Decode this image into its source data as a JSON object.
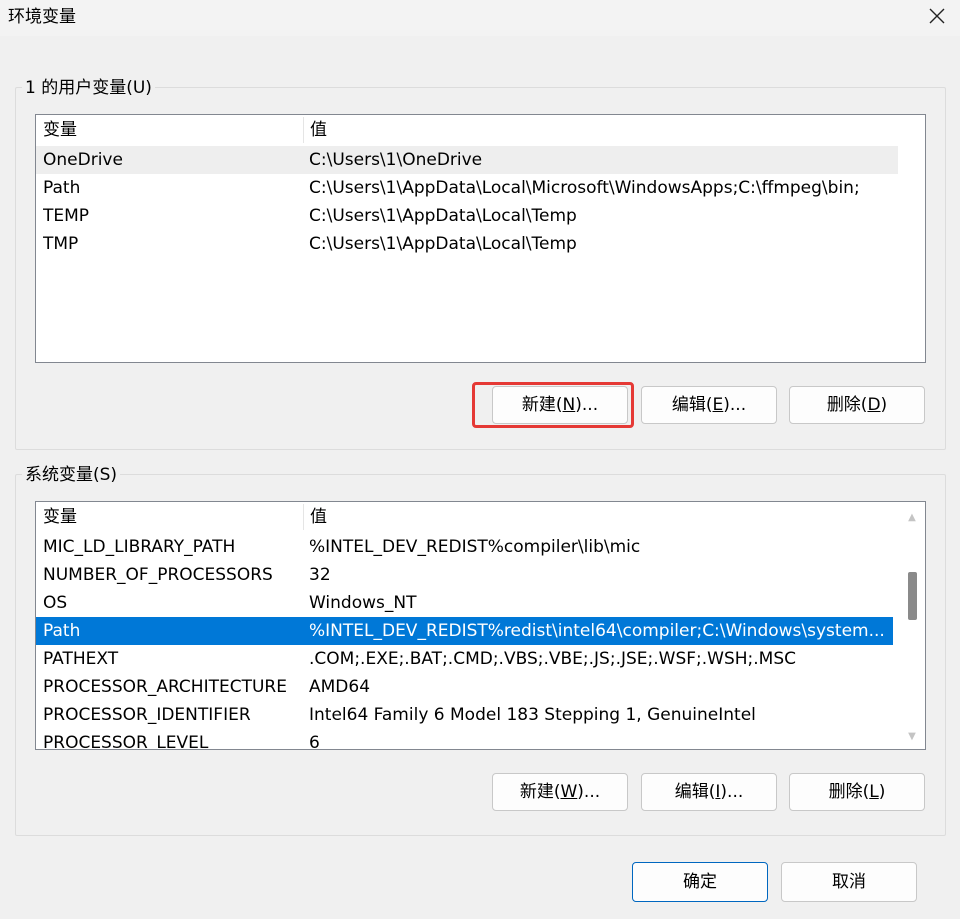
{
  "window": {
    "title": "环境变量",
    "close_icon": "close-icon"
  },
  "user_vars": {
    "group_label": "1 的用户变量(U)",
    "columns": [
      "变量",
      "值"
    ],
    "rows": [
      {
        "name": "OneDrive",
        "value": "C:\\Users\\1\\OneDrive"
      },
      {
        "name": "Path",
        "value": "C:\\Users\\1\\AppData\\Local\\Microsoft\\WindowsApps;C:\\ffmpeg\\bin;"
      },
      {
        "name": "TEMP",
        "value": "C:\\Users\\1\\AppData\\Local\\Temp"
      },
      {
        "name": "TMP",
        "value": "C:\\Users\\1\\AppData\\Local\\Temp"
      }
    ],
    "buttons": {
      "new": {
        "pre": "新建(",
        "key": "N",
        "post": ")..."
      },
      "edit": {
        "pre": "编辑(",
        "key": "E",
        "post": ")..."
      },
      "delete": {
        "pre": "删除(",
        "key": "D",
        "post": ")"
      }
    }
  },
  "system_vars": {
    "group_label": "系统变量(S)",
    "columns": [
      "变量",
      "值"
    ],
    "rows": [
      {
        "name": "MIC_LD_LIBRARY_PATH",
        "value": "%INTEL_DEV_REDIST%compiler\\lib\\mic"
      },
      {
        "name": "NUMBER_OF_PROCESSORS",
        "value": "32"
      },
      {
        "name": "OS",
        "value": "Windows_NT"
      },
      {
        "name": "Path",
        "value": "%INTEL_DEV_REDIST%redist\\intel64\\compiler;C:\\Windows\\system..."
      },
      {
        "name": "PATHEXT",
        "value": ".COM;.EXE;.BAT;.CMD;.VBS;.VBE;.JS;.JSE;.WSF;.WSH;.MSC"
      },
      {
        "name": "PROCESSOR_ARCHITECTURE",
        "value": "AMD64"
      },
      {
        "name": "PROCESSOR_IDENTIFIER",
        "value": "Intel64 Family 6 Model 183 Stepping 1, GenuineIntel"
      },
      {
        "name": "PROCESSOR_LEVEL",
        "value": "6"
      }
    ],
    "selected_row": 3,
    "buttons": {
      "new": {
        "pre": "新建(",
        "key": "W",
        "post": ")..."
      },
      "edit": {
        "pre": "编辑(",
        "key": "I",
        "post": ")..."
      },
      "delete": {
        "pre": "删除(",
        "key": "L",
        "post": ")"
      }
    }
  },
  "footer": {
    "ok": "确定",
    "cancel": "取消"
  },
  "colors": {
    "selection": "#0078d7",
    "highlight": "#e53935"
  }
}
